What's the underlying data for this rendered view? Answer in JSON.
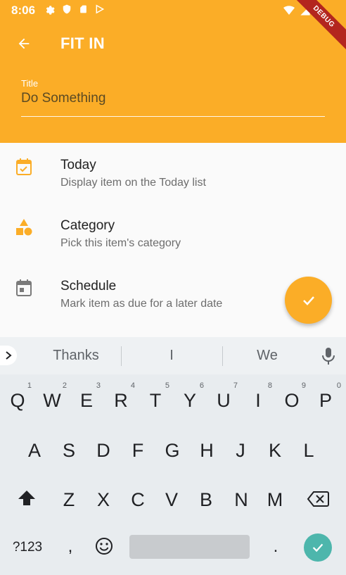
{
  "status_bar": {
    "time": "8:06",
    "debug_label": "DEBUG"
  },
  "app_bar": {
    "title": "FIT IN",
    "color": "#fbad27"
  },
  "title_field": {
    "label": "Title",
    "value": "Do Something"
  },
  "list": [
    {
      "title": "Today",
      "subtitle": "Display item on the Today list",
      "icon": "calendar-check-icon"
    },
    {
      "title": "Category",
      "subtitle": "Pick this item's category",
      "icon": "category-shapes-icon"
    },
    {
      "title": "Schedule",
      "subtitle": "Mark item as due for a later date",
      "icon": "calendar-icon"
    }
  ],
  "keyboard": {
    "suggestions": [
      "Thanks",
      "I",
      "We"
    ],
    "row1": [
      "Q",
      "W",
      "E",
      "R",
      "T",
      "Y",
      "U",
      "I",
      "O",
      "P"
    ],
    "row1_hints": [
      "1",
      "2",
      "3",
      "4",
      "5",
      "6",
      "7",
      "8",
      "9",
      "0"
    ],
    "row2": [
      "A",
      "S",
      "D",
      "F",
      "G",
      "H",
      "J",
      "K",
      "L"
    ],
    "row3": [
      "Z",
      "X",
      "C",
      "V",
      "B",
      "N",
      "M"
    ],
    "symbols_key": "?123",
    "comma": ",",
    "period": ".",
    "accent": "#4db6ac"
  }
}
